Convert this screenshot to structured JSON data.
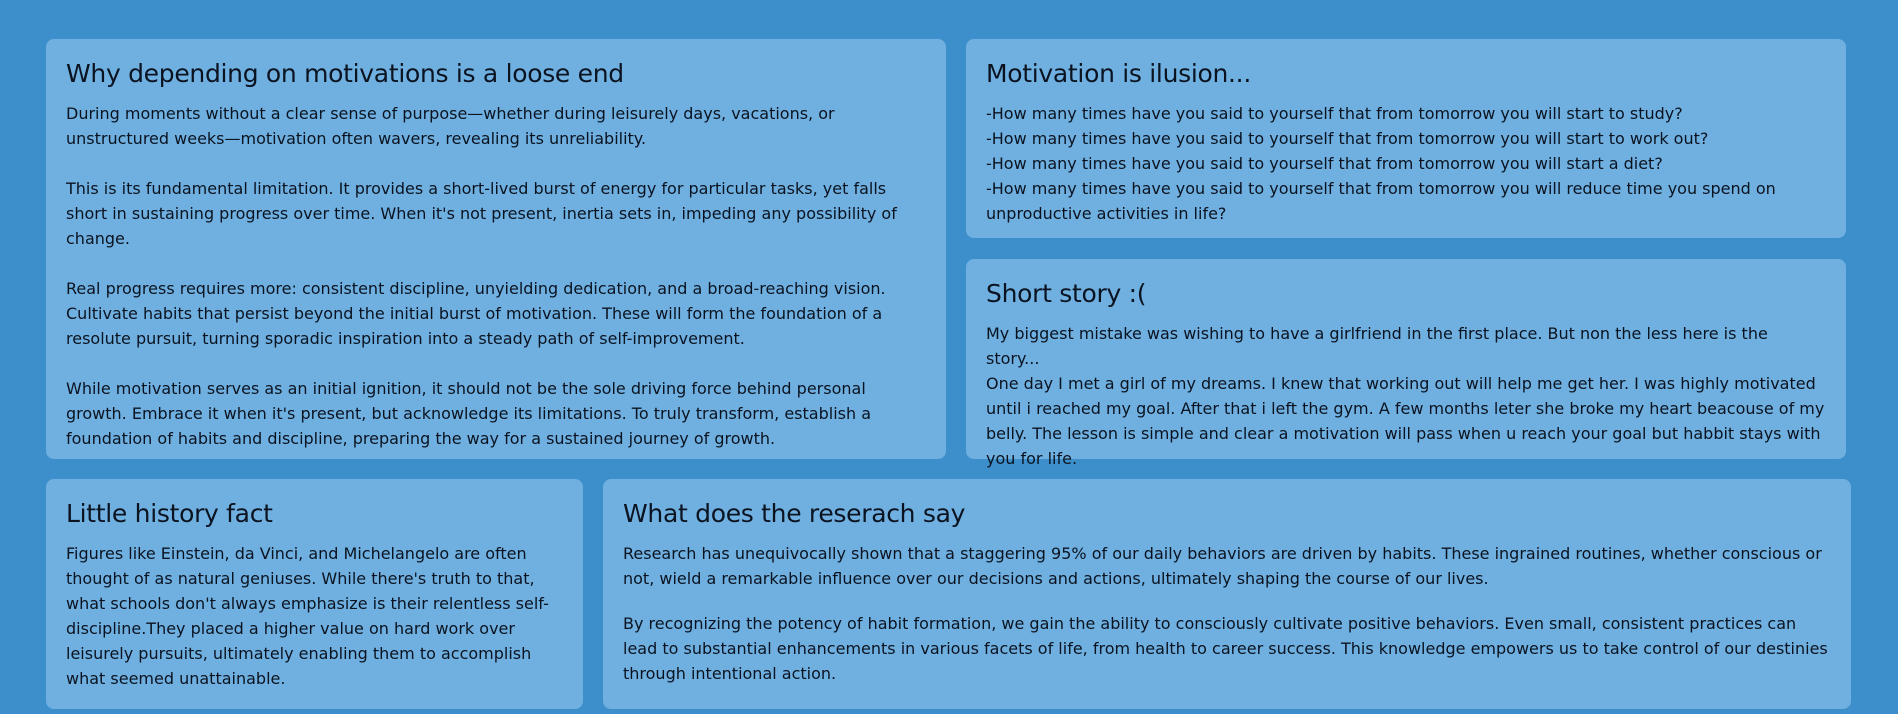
{
  "cards": {
    "why": {
      "title": "Why depending on motivations is a loose end",
      "paragraphs": [
        "During moments without a clear sense of purpose—whether during leisurely days, vacations, or unstructured weeks—motivation often wavers, revealing its unreliability.",
        "This is its fundamental limitation. It provides a short-lived burst of energy for particular tasks, yet falls short in sustaining progress over time. When it's not present, inertia sets in, impeding any possibility of change.",
        "Real progress requires more: consistent discipline, unyielding dedication, and a broad-reaching vision. Cultivate habits that persist beyond the initial burst of motivation. These will form the foundation of a resolute pursuit, turning sporadic inspiration into a steady path of self-improvement.",
        "While motivation serves as an initial ignition, it should not be the sole driving force behind personal growth. Embrace it when it's present, but acknowledge its limitations. To truly transform, establish a foundation of habits and discipline, preparing the way for a sustained journey of growth."
      ]
    },
    "illusion": {
      "title": "Motivation is ilusion...",
      "lines": [
        "-How many times have you said to yourself that from tomorrow you will start to study?",
        "-How many times have you said to yourself that from tomorrow you will start to work out?",
        "-How many times have you said to yourself that from tomorrow you will start a diet?",
        "-How many times have you said to yourself that from tomorrow you will reduce time you spend on unproductive activities in life?"
      ]
    },
    "story": {
      "title": "Short story :(",
      "lines": [
        "My biggest mistake was wishing to have a girlfriend in the first place. But non the less here is the story...",
        "One day I met a girl of my dreams. I knew that working out will help me get her. I was highly motivated until i reached my goal. After that i left the gym. A few months leter she broke my heart beacouse of my belly. The lesson is simple and clear a motivation will pass when u reach your goal but habbit stays with you for life."
      ]
    },
    "history": {
      "title": "Little history fact",
      "paragraphs": [
        "Figures like Einstein, da Vinci, and Michelangelo are often thought of as natural geniuses. While there's truth to that, what schools don't always emphasize is their relentless self-discipline.They placed a higher value on hard work over leisurely pursuits, ultimately enabling them to accomplish what seemed unattainable."
      ]
    },
    "research": {
      "title": "What does the reserach say",
      "paragraphs": [
        "Research has unequivocally shown that a staggering 95% of our daily behaviors are driven by habits. These ingrained routines, whether conscious or not, wield a remarkable influence over our decisions and actions, ultimately shaping the course of our lives.",
        "By recognizing the potency of habit formation, we gain the ability to consciously cultivate positive behaviors. Even small, consistent practices can lead to substantial enhancements in various facets of life, from health to career success. This knowledge empowers us to take control of our destinies through intentional action."
      ]
    }
  }
}
